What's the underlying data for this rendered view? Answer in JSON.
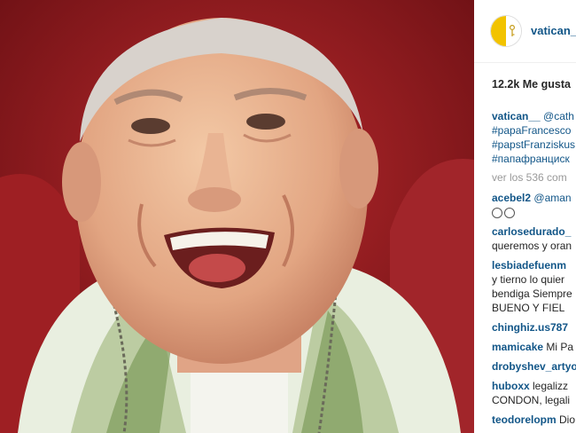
{
  "post": {
    "username": "vatican__",
    "likes": "12.2k Me gusta",
    "caption": {
      "user": "vatican__",
      "mention": "@cath",
      "tags": [
        "#papaFrancesco",
        "#papstFranziskus",
        "#папафранциск"
      ]
    },
    "view_all": "ver los 536 com"
  },
  "comments": [
    {
      "user": "acebel2",
      "text": "@aman",
      "line2": ""
    },
    {
      "user": "carlosedurado_",
      "line2": "queremos y oran"
    },
    {
      "user": "lesbiadefuenm",
      "line2": "y tierno lo quier",
      "line3": "bendiga Siempre",
      "line4": "BUENO Y FIEL"
    },
    {
      "user": "chinghiz.us787"
    },
    {
      "user": "mamicake",
      "text": "Mi Pa"
    },
    {
      "user": "drobyshev_artyo"
    },
    {
      "user": "huboxx",
      "text": "legalizz",
      "line2": "CONDON, legali"
    },
    {
      "user": "teodorelopm",
      "text": "Dio"
    }
  ],
  "colors": {
    "link": "#125688",
    "text": "#262626",
    "muted": "#999999",
    "flag_yellow": "#f2c300"
  }
}
